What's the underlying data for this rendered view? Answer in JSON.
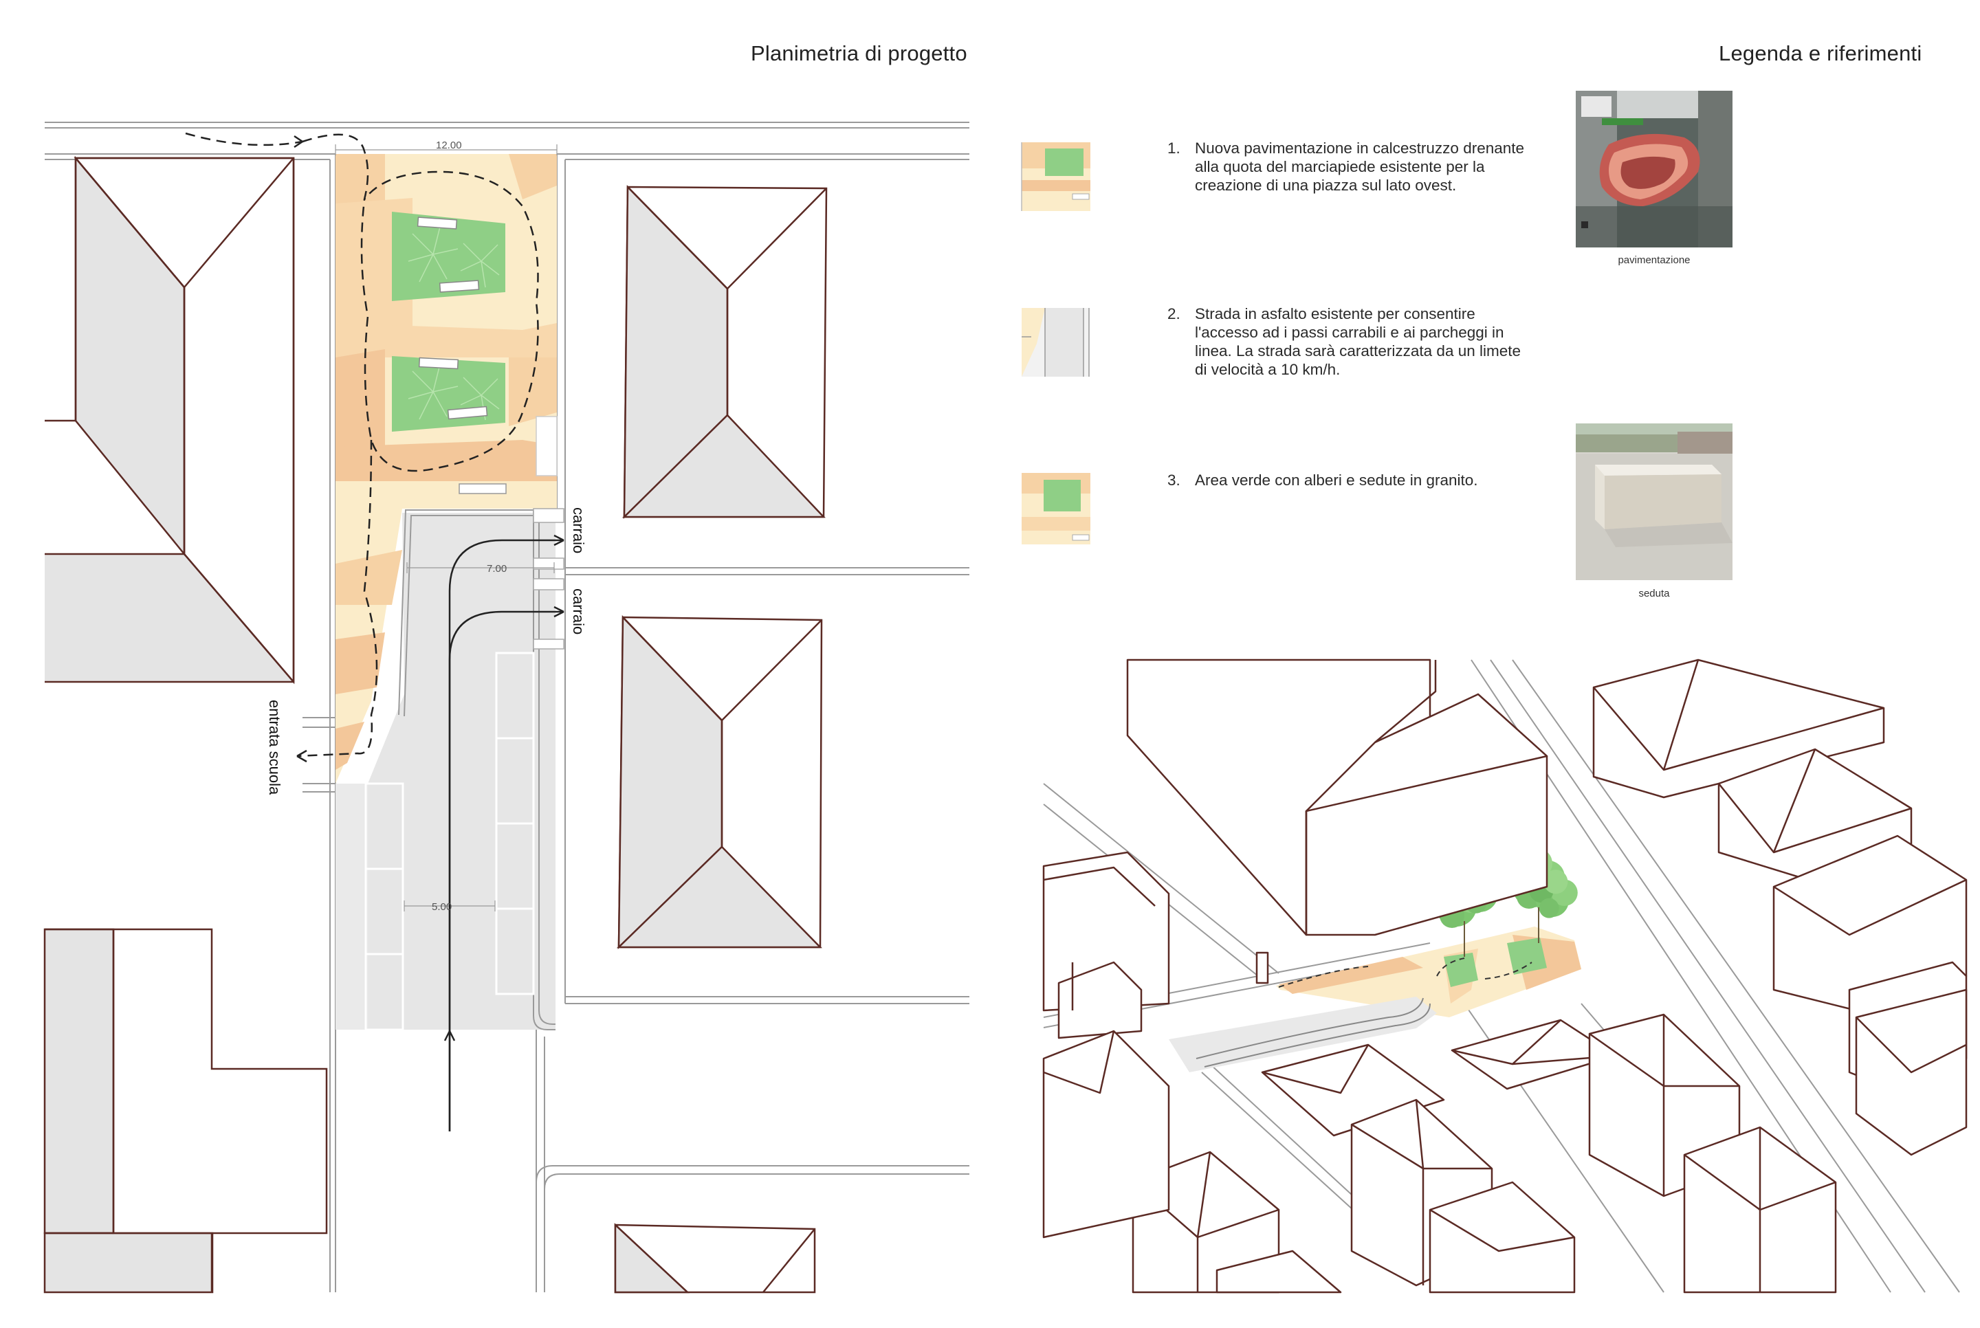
{
  "titles": {
    "plan": "Planimetria di progetto",
    "legend": "Legenda e riferimenti"
  },
  "plan_labels": {
    "dim_top": "12.00",
    "dim_mid": "7.00",
    "dim_parking": "5.00",
    "carraio_1": "carraio",
    "carraio_2": "carraio",
    "school_entrance": "entrata scuola"
  },
  "legend_items": [
    {
      "num": "1.",
      "text": "Nuova pavimentazione in calcestruzzo drenante alla quota del marciapiede esistente per la creazione di una piazza sul lato ovest."
    },
    {
      "num": "2.",
      "text": "Strada in asfalto esistente per consentire l'accesso ad i passi carrabili e ai parcheggi in linea. La strada sarà caratterizzata da un limete di velocità a 10 km/h."
    },
    {
      "num": "3.",
      "text": "Area verde con alberi e sedute in granito."
    }
  ],
  "references": [
    {
      "caption": "pavimentazione"
    },
    {
      "caption": "seduta"
    }
  ],
  "colors": {
    "building_line": "#5b2a24",
    "paving_light": "#fbecc9",
    "paving_mid": "#f8d8ad",
    "paving_dark": "#f3c79a",
    "green": "#8fcf86",
    "asphalt": "#e6e6e6",
    "roof_shade": "#e4e4e4"
  }
}
